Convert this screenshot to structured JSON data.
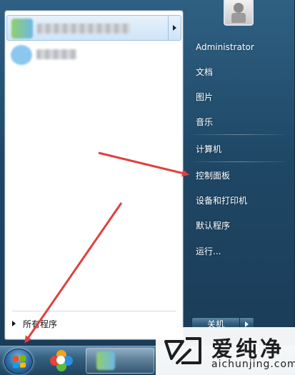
{
  "left_pane": {
    "pinned_items": [
      {
        "label": "",
        "icon": "app-icon",
        "highlighted": true,
        "has_submenu": true
      },
      {
        "label": "",
        "icon": "app-icon",
        "highlighted": false,
        "has_submenu": false
      }
    ],
    "all_programs_label": "所有程序"
  },
  "user": {
    "picture_icon": "robot-avatar-icon"
  },
  "right_pane": {
    "username": "Administrator",
    "items": [
      "文档",
      "图片",
      "音乐",
      "计算机",
      "控制面板",
      "设备和打印机",
      "默认程序",
      "运行..."
    ]
  },
  "shutdown": {
    "label": "关机"
  },
  "taskbar": {
    "start_icon": "windows-orb-icon",
    "pinned_icon": "pinwheel-icon"
  },
  "watermark": {
    "text": "爱纯净",
    "subtext": "aichunjing.com"
  },
  "colors": {
    "frame": "#1f4866",
    "highlight": "#cfe4f7",
    "annotation_arrow": "#e0413f"
  }
}
